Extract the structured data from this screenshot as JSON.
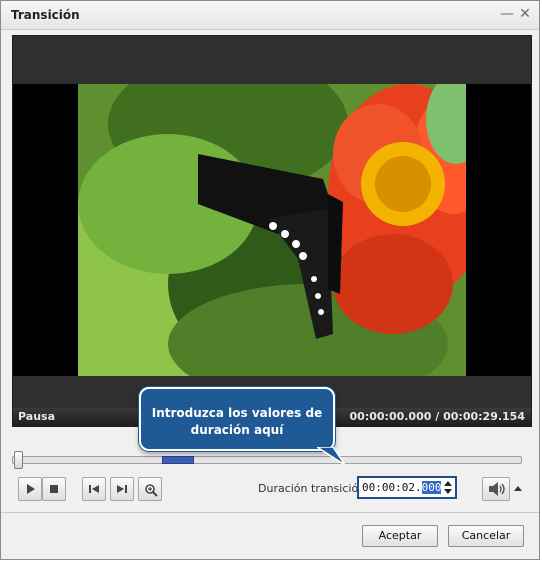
{
  "window": {
    "title": "Transición"
  },
  "viewer": {
    "status_left": "Pausa",
    "current_time": "00:00:00.000",
    "time_separator": "/",
    "total_time": "00:00:29.154"
  },
  "callout": {
    "line1": "Introduzca los valores de",
    "line2": "duración aquí"
  },
  "duration": {
    "label": "Duración transición:",
    "value_prefix": "00:00:02.",
    "value_selected": "000"
  },
  "controls": {
    "icons": [
      "play-icon",
      "stop-icon",
      "previous-frame-icon",
      "next-frame-icon",
      "zoom-icon",
      "volume-icon",
      "dropdown-arrow-icon"
    ]
  },
  "dialog": {
    "accept_label": "Aceptar",
    "cancel_label": "Cancelar"
  },
  "colors": {
    "callout": "#1f5a96",
    "timeline_range": "#3d5db5",
    "selection": "#316ac5"
  }
}
